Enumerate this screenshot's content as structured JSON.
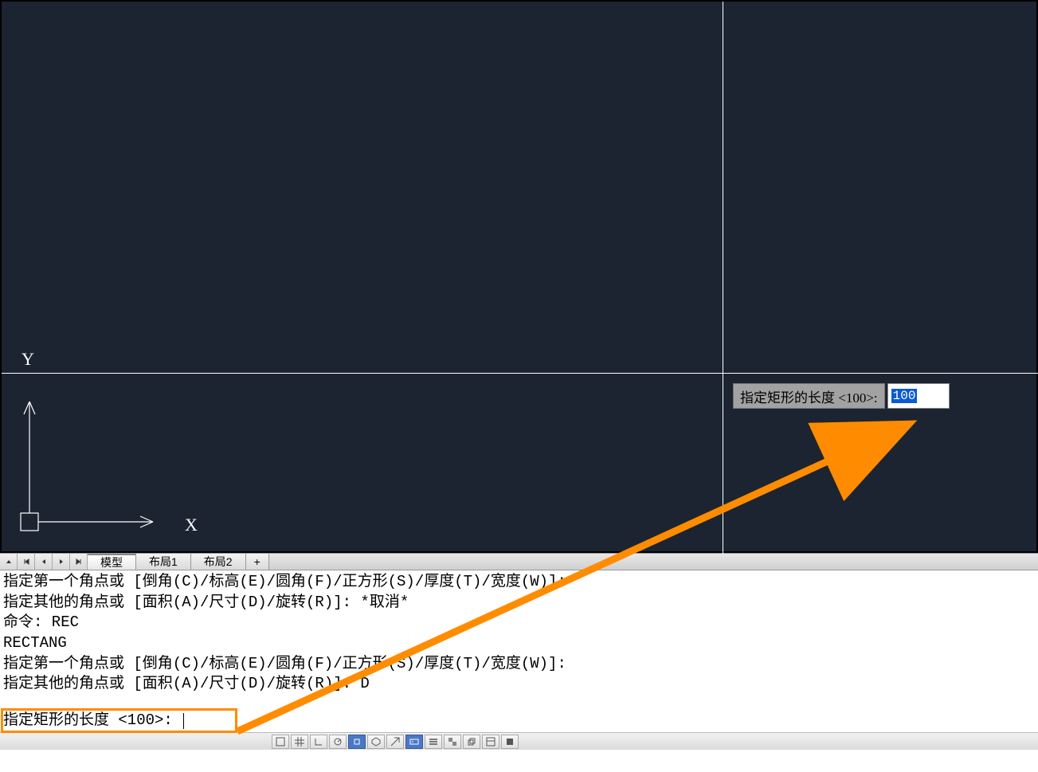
{
  "viewport": {
    "y_axis_label": "Y",
    "x_axis_label": "X"
  },
  "dynamic_prompt": {
    "label": "指定矩形的长度 <100>:",
    "value": "100"
  },
  "tabs": {
    "model": "模型",
    "layout1": "布局1",
    "layout2": "布局2",
    "add": "+"
  },
  "command_history": [
    "指定第一个角点或 [倒角(C)/标高(E)/圆角(F)/正方形(S)/厚度(T)/宽度(W)]:",
    "指定其他的角点或 [面积(A)/尺寸(D)/旋转(R)]: *取消*",
    "命令: REC",
    "RECTANG",
    "指定第一个角点或 [倒角(C)/标高(E)/圆角(F)/正方形(S)/厚度(T)/宽度(W)]:",
    "指定其他的角点或 [面积(A)/尺寸(D)/旋转(R)]: D"
  ],
  "command_line": {
    "prompt": "指定矩形的长度 <100>: "
  },
  "colors": {
    "annotation_orange": "#ff8c00",
    "canvas_bg": "#1c2432",
    "selection_blue": "#0a5ad6"
  }
}
